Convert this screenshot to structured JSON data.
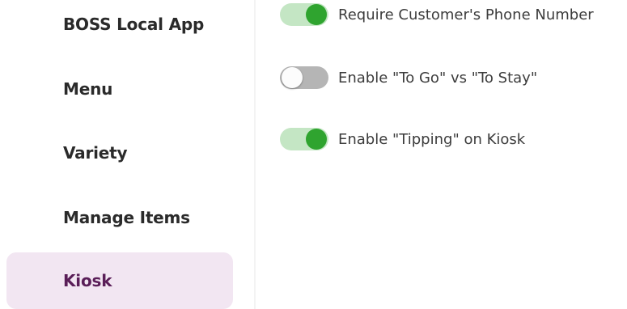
{
  "sidebar": {
    "items": [
      {
        "label": "BOSS Local App",
        "active": false
      },
      {
        "label": "Menu",
        "active": false
      },
      {
        "label": "Variety",
        "active": false
      },
      {
        "label": "Manage Items",
        "active": false
      },
      {
        "label": "Kiosk",
        "active": true
      }
    ]
  },
  "settings": [
    {
      "label": "Require Customer's Phone Number",
      "enabled": true
    },
    {
      "label": "Enable \"To Go\" vs \"To Stay\"",
      "enabled": false
    },
    {
      "label": "Enable \"Tipping\" on Kiosk",
      "enabled": true
    }
  ],
  "colors": {
    "active_nav_bg": "#f2e6f2",
    "active_nav_text": "#5a1e58",
    "toggle_on_track": "#c4e6c4",
    "toggle_on_knob": "#2fa42f",
    "toggle_off_track": "#b5b5b5"
  }
}
